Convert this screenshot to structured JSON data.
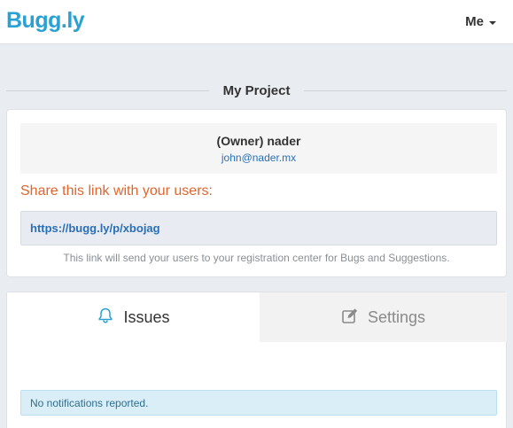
{
  "navbar": {
    "brand": "Bugg.ly",
    "user_menu_label": "Me"
  },
  "project": {
    "title": "My Project",
    "owner_name": "(Owner) nader",
    "owner_email": "john@nader.mx",
    "share_title": "Share this link with your users:",
    "share_link": "https://bugg.ly/p/xbojag",
    "share_help": "This link will send your users to your registration center for Bugs and Suggestions."
  },
  "tabs": [
    {
      "label": "Issues",
      "icon": "bell-icon",
      "active": true
    },
    {
      "label": "Settings",
      "icon": "edit-icon",
      "active": false
    }
  ],
  "issues": {
    "empty_message": "No notifications reported."
  },
  "colors": {
    "brand": "#2aa1d4",
    "share_title": "#e0652d",
    "link": "#2a6fb5",
    "info_bg": "#d9eef7"
  }
}
